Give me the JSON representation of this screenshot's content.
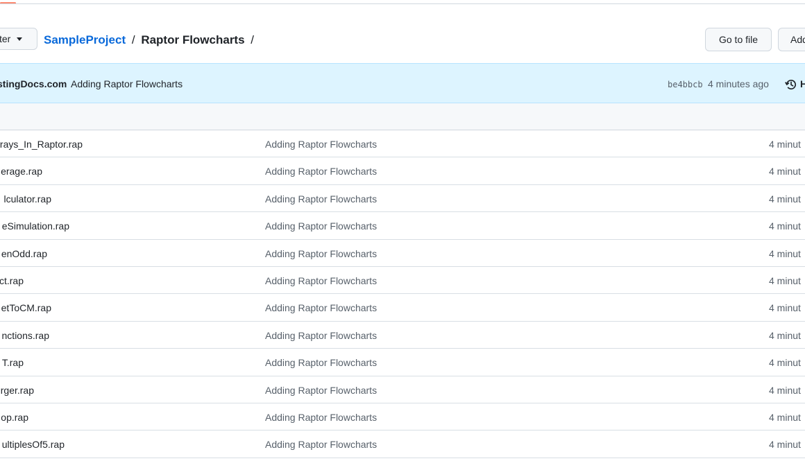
{
  "toolbar": {
    "branch_label": "ter",
    "breadcrumb_repo": "SampleProject",
    "breadcrumb_sep1": "/",
    "breadcrumb_folder": "Raptor Flowcharts",
    "breadcrumb_sep2": "/",
    "goto_file_label": "Go to file",
    "add_file_label": "Add"
  },
  "commit": {
    "author": "stingDocs.com",
    "message": "Adding Raptor Flowcharts",
    "sha": "be4bbcb",
    "time": "4 minutes ago",
    "history_label": "H"
  },
  "files": [
    {
      "name": "rays_In_Raptor.rap",
      "commit": "Adding Raptor Flowcharts",
      "time": "4 minut"
    },
    {
      "name": "erage.rap",
      "commit": "Adding Raptor Flowcharts",
      "time": "4 minut"
    },
    {
      "name": "lculator.rap",
      "commit": "Adding Raptor Flowcharts",
      "time": "4 minut"
    },
    {
      "name": "eSimulation.rap",
      "commit": "Adding Raptor Flowcharts",
      "time": "4 minut"
    },
    {
      "name": "enOdd.rap",
      "commit": "Adding Raptor Flowcharts",
      "time": "4 minut"
    },
    {
      "name": "ct.rap",
      "commit": "Adding Raptor Flowcharts",
      "time": "4 minut"
    },
    {
      "name": "etToCM.rap",
      "commit": "Adding Raptor Flowcharts",
      "time": "4 minut"
    },
    {
      "name": "nctions.rap",
      "commit": "Adding Raptor Flowcharts",
      "time": "4 minut"
    },
    {
      "name": "T.rap",
      "commit": "Adding Raptor Flowcharts",
      "time": "4 minut"
    },
    {
      "name": "rger.rap",
      "commit": "Adding Raptor Flowcharts",
      "time": "4 minut"
    },
    {
      "name": "op.rap",
      "commit": "Adding Raptor Flowcharts",
      "time": "4 minut"
    },
    {
      "name": "ultiplesOf5.rap",
      "commit": "Adding Raptor Flowcharts",
      "time": "4 minut"
    }
  ],
  "colors": {
    "link": "#0969da",
    "commit_bar": "#ddf4ff",
    "accent": "#fd8c73"
  },
  "icons": {
    "branch_caret": "caret-down-icon",
    "history": "history-icon"
  }
}
